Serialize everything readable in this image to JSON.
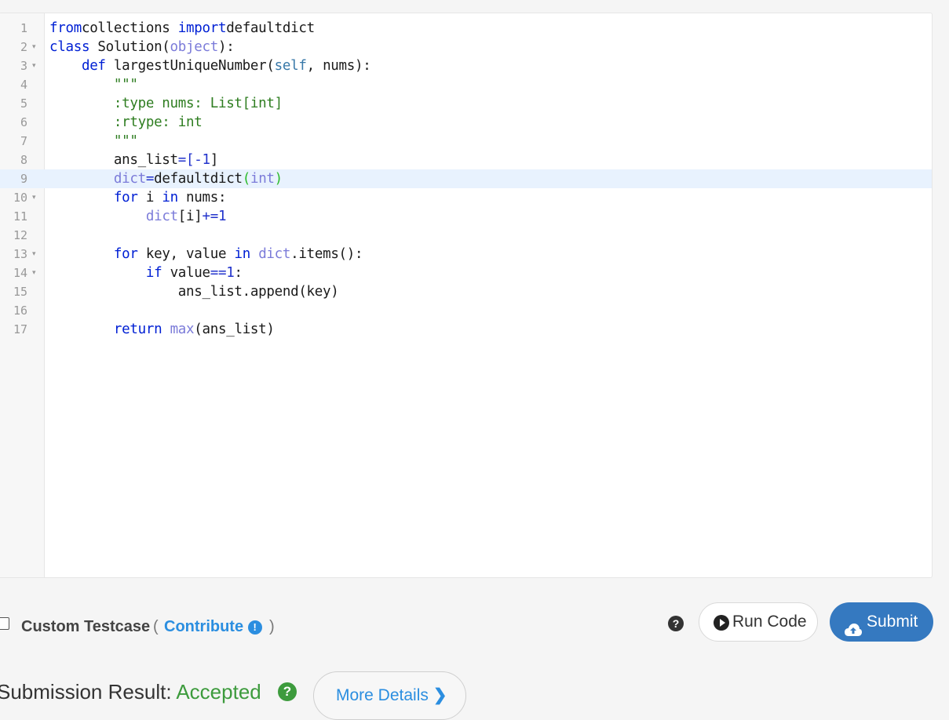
{
  "editor": {
    "lines": [
      {
        "n": "1",
        "fold": false,
        "active": false
      },
      {
        "n": "2",
        "fold": true,
        "active": false
      },
      {
        "n": "3",
        "fold": true,
        "active": false
      },
      {
        "n": "4",
        "fold": false,
        "active": false
      },
      {
        "n": "5",
        "fold": false,
        "active": false
      },
      {
        "n": "6",
        "fold": false,
        "active": false
      },
      {
        "n": "7",
        "fold": false,
        "active": false
      },
      {
        "n": "8",
        "fold": false,
        "active": false
      },
      {
        "n": "9",
        "fold": false,
        "active": true
      },
      {
        "n": "10",
        "fold": true,
        "active": false
      },
      {
        "n": "11",
        "fold": false,
        "active": false
      },
      {
        "n": "12",
        "fold": false,
        "active": false
      },
      {
        "n": "13",
        "fold": true,
        "active": false
      },
      {
        "n": "14",
        "fold": true,
        "active": false
      },
      {
        "n": "15",
        "fold": false,
        "active": false
      },
      {
        "n": "16",
        "fold": false,
        "active": false
      },
      {
        "n": "17",
        "fold": false,
        "active": false
      }
    ],
    "code": [
      [
        [
          "kw",
          "from"
        ],
        [
          "",
          "collections "
        ],
        [
          "kw",
          "import"
        ],
        [
          "",
          "defaultdict"
        ]
      ],
      [
        [
          "kw",
          "class"
        ],
        [
          "",
          " Solution("
        ],
        [
          "bi",
          "object"
        ],
        [
          "",
          "):"
        ]
      ],
      [
        [
          "",
          "    "
        ],
        [
          "kw",
          "def"
        ],
        [
          "",
          " largestUniqueNumber("
        ],
        [
          "sl",
          "self"
        ],
        [
          "",
          ", nums):"
        ]
      ],
      [
        [
          "str",
          "        \"\"\""
        ]
      ],
      [
        [
          "str",
          "        :type nums: List[int]"
        ]
      ],
      [
        [
          "str",
          "        :rtype: int"
        ]
      ],
      [
        [
          "str",
          "        \"\"\""
        ]
      ],
      [
        [
          "",
          "        ans_list"
        ],
        [
          "op",
          "=["
        ],
        [
          "num",
          "-1"
        ],
        [
          "",
          "]"
        ]
      ],
      [
        [
          "",
          "        "
        ],
        [
          "bi",
          "dict"
        ],
        [
          "op",
          "="
        ],
        [
          "",
          "defaultdict"
        ],
        [
          "green",
          "("
        ],
        [
          "bi",
          "int"
        ],
        [
          "green",
          ")"
        ]
      ],
      [
        [
          "",
          "        "
        ],
        [
          "kw",
          "for"
        ],
        [
          "",
          " i "
        ],
        [
          "kw",
          "in"
        ],
        [
          "",
          " nums:"
        ]
      ],
      [
        [
          "",
          "            "
        ],
        [
          "bi",
          "dict"
        ],
        [
          "",
          "[i]"
        ],
        [
          "op",
          "+="
        ],
        [
          "num",
          "1"
        ]
      ],
      [
        [
          "",
          ""
        ]
      ],
      [
        [
          "",
          "        "
        ],
        [
          "kw",
          "for"
        ],
        [
          "",
          " key, value "
        ],
        [
          "kw",
          "in"
        ],
        [
          "",
          " "
        ],
        [
          "bi",
          "dict"
        ],
        [
          "",
          ".items():"
        ]
      ],
      [
        [
          "",
          "            "
        ],
        [
          "kw",
          "if"
        ],
        [
          "",
          " value"
        ],
        [
          "op",
          "=="
        ],
        [
          "num",
          "1"
        ],
        [
          "",
          ":"
        ]
      ],
      [
        [
          "",
          "                ans_list.append(key)"
        ]
      ],
      [
        [
          "",
          ""
        ]
      ],
      [
        [
          "",
          "        "
        ],
        [
          "kw",
          "return"
        ],
        [
          "",
          " "
        ],
        [
          "bi",
          "max"
        ],
        [
          "",
          "(ans_list)"
        ]
      ]
    ]
  },
  "bottom": {
    "custom_testcase_label": "Custom Testcase",
    "paren_open": "(",
    "contribute_label": "Contribute",
    "paren_close": ")",
    "help_glyph": "?",
    "run_code_label": "Run Code",
    "submit_label": "Submit"
  },
  "result": {
    "title": "Submission Result: ",
    "status": "Accepted",
    "more_details_label": "More Details"
  },
  "colors": {
    "accent_blue": "#3579c0",
    "link_blue": "#2b8ee0",
    "accepted_green": "#3d9b3d"
  }
}
